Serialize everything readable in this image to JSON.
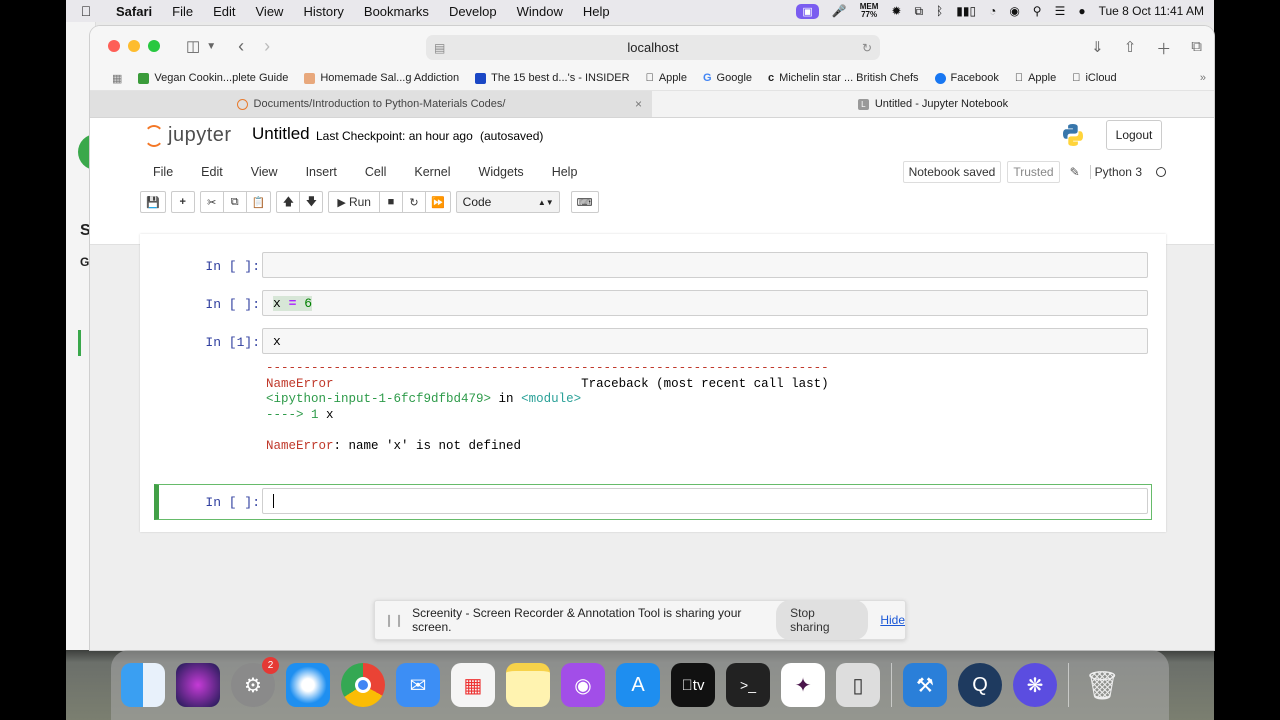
{
  "menubar": {
    "app": "Safari",
    "items": [
      "File",
      "Edit",
      "View",
      "History",
      "Bookmarks",
      "Develop",
      "Window",
      "Help"
    ],
    "memory": "77%",
    "memory_label": "MEM",
    "datetime": "Tue 8 Oct  11:41 AM"
  },
  "browser": {
    "url": "localhost",
    "favorites": [
      "Vegan Cookin...plete Guide",
      "Homemade Sal...g Addiction",
      "The 15 best d...'s - INSIDER",
      "Apple",
      "Google",
      "Michelin star ... British Chefs",
      "Facebook",
      "Apple",
      "iCloud"
    ],
    "favorites_more": "»",
    "tabs": [
      {
        "title": "Documents/Introduction to Python-Materials Codes/",
        "close": "×"
      },
      {
        "title": "Untitled - Jupyter Notebook",
        "favicon": "L"
      }
    ]
  },
  "jupyter": {
    "logo_text": "jupyter",
    "notebook_title": "Untitled",
    "checkpoint": "Last Checkpoint: an hour ago",
    "autosave": "(autosaved)",
    "logout": "Logout",
    "menu": [
      "File",
      "Edit",
      "View",
      "Insert",
      "Cell",
      "Kernel",
      "Widgets",
      "Help"
    ],
    "status_saved": "Notebook saved",
    "status_trusted": "Trusted",
    "kernel_name": "Python 3",
    "toolbar": {
      "run_label": "Run",
      "cell_type": "Code"
    },
    "cells": [
      {
        "prompt": "In [ ]:",
        "code": ""
      },
      {
        "prompt": "In [ ]:",
        "code_var": "x",
        "code_op": "=",
        "code_num": "6"
      },
      {
        "prompt": "In [1]:",
        "code": "x"
      },
      {
        "prompt": "In [ ]:",
        "code": ""
      }
    ],
    "traceback": {
      "rule": "---------------------------------------------------------------------------",
      "error_name": "NameError",
      "traceback_header": "Traceback (most recent call last)",
      "input_ref": "<ipython-input-1-6fcf9dfbd479>",
      "in_word": " in ",
      "module": "<module>",
      "arrow": "----> 1 ",
      "arrow_code": "x",
      "error_name2": "NameError",
      "error_msg": ": name 'x' is not defined"
    }
  },
  "share_banner": {
    "message": "Screenity - Screen Recorder & Annotation Tool is sharing your screen.",
    "stop": "Stop sharing",
    "hide": "Hide"
  },
  "behind_window": {
    "t1": "S",
    "t2": "G"
  },
  "dock": {
    "settings_badge": "2",
    "tv_label": "tv"
  }
}
